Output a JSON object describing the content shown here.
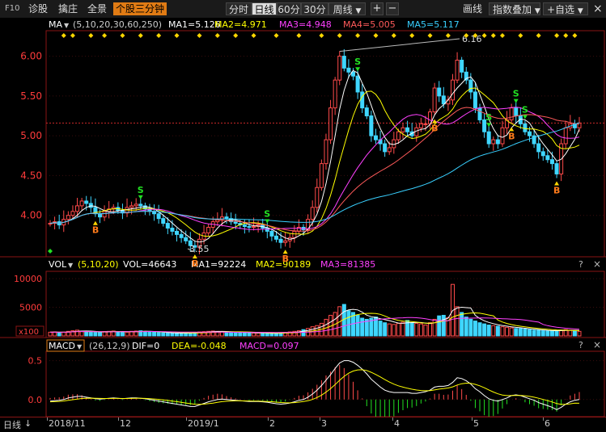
{
  "toolbar": {
    "f10": "F10",
    "nav": [
      "诊股",
      "擒庄",
      "全景",
      "个股三分钟"
    ],
    "nav_active": 3,
    "periods": [
      "分时",
      "日线",
      "60分",
      "30分",
      "周线"
    ],
    "period_active": 1,
    "dropdown_icon": "chevron-down-icon",
    "plus": "+",
    "minus": "−",
    "draw": "画线",
    "overlay": "指数叠加",
    "watchlist": "+自选",
    "close": "×"
  },
  "price_legend": {
    "name": "MA",
    "params": "(5,10,20,30,60,250)",
    "items": [
      "MA1=5.126",
      "MA2=4.971",
      "MA3=4.948",
      "MA4=5.005",
      "MA5=5.117"
    ],
    "colors": [
      "#ffffff",
      "#ffff00",
      "#ff40ff",
      "#ff5a5a",
      "#39d0ff"
    ]
  },
  "vol_legend": {
    "name": "VOL",
    "params": "(5,10,20)",
    "items": [
      "VOL=46643",
      "MA1=92224",
      "MA2=90189",
      "MA3=81385"
    ]
  },
  "macd_legend": {
    "name": "MACD",
    "params": "(26,12,9)",
    "items": [
      "DIF=0",
      "DEA=-0.048",
      "MACD=0.097"
    ]
  },
  "panel_controls": [
    "?",
    "×"
  ],
  "price_annotations": {
    "high": "6.16",
    "low": "3.55"
  },
  "signals": {
    "buy": "B",
    "sell": "S"
  },
  "vol_unit": "x100",
  "period_label": "日线",
  "x_labels": [
    "2018/11",
    "12",
    "2019/1",
    "2",
    "3",
    "4",
    "5",
    "6"
  ],
  "chart_data": [
    {
      "type": "line",
      "panel": "price",
      "ylim": [
        3.5,
        6.3
      ],
      "yticks": [
        "6.00",
        "5.50",
        "5.00",
        "4.50",
        "4.00"
      ],
      "ref_line": 5.16,
      "close": [
        3.9,
        3.92,
        3.88,
        3.95,
        4.0,
        4.05,
        4.12,
        4.18,
        4.15,
        4.1,
        4.02,
        3.98,
        4.05,
        4.08,
        4.1,
        4.06,
        4.03,
        4.1,
        4.12,
        4.14,
        4.12,
        4.08,
        4.05,
        4.02,
        3.96,
        3.9,
        3.84,
        3.8,
        3.76,
        3.72,
        3.68,
        3.62,
        3.6,
        3.7,
        3.78,
        3.85,
        3.92,
        3.95,
        3.98,
        3.96,
        3.92,
        3.9,
        3.88,
        3.86,
        3.85,
        3.86,
        3.88,
        3.84,
        3.8,
        3.74,
        3.7,
        3.66,
        3.68,
        3.72,
        3.8,
        3.85,
        3.82,
        3.95,
        4.1,
        4.35,
        4.65,
        4.95,
        5.35,
        5.7,
        6.0,
        5.85,
        5.8,
        5.75,
        5.55,
        5.35,
        5.25,
        5.0,
        4.95,
        4.9,
        4.8,
        4.85,
        4.95,
        5.05,
        5.1,
        5.05,
        5.0,
        5.1,
        5.15,
        5.15,
        5.3,
        5.6,
        5.5,
        5.4,
        5.45,
        5.7,
        5.95,
        5.8,
        5.7,
        5.55,
        5.35,
        5.2,
        5.05,
        4.9,
        4.95,
        4.9,
        5.1,
        5.2,
        5.35,
        5.25,
        5.15,
        5.05,
        5.0,
        4.9,
        4.8,
        4.75,
        4.7,
        4.65,
        4.52,
        4.9,
        5.1,
        5.15,
        5.1,
        5.16
      ]
    },
    {
      "type": "bar",
      "panel": "volume",
      "ylim": [
        0,
        11000
      ],
      "yticks": [
        "10000",
        "5000"
      ],
      "values": [
        650,
        700,
        600,
        650,
        800,
        900,
        1000,
        850,
        750,
        700,
        650,
        600,
        750,
        800,
        850,
        750,
        700,
        650,
        800,
        850,
        900,
        800,
        700,
        650,
        600,
        550,
        500,
        450,
        450,
        500,
        550,
        500,
        600,
        700,
        750,
        800,
        850,
        800,
        750,
        700,
        650,
        600,
        550,
        600,
        550,
        500,
        500,
        450,
        450,
        450,
        500,
        550,
        600,
        700,
        800,
        900,
        1100,
        1300,
        1600,
        1800,
        2200,
        2900,
        3600,
        4100,
        5100,
        5500,
        4400,
        4100,
        3600,
        3100,
        2900,
        3100,
        3300,
        2600,
        2300,
        2100,
        2000,
        2200,
        2400,
        2700,
        2300,
        2200,
        2100,
        1900,
        2300,
        2900,
        3500,
        3600,
        3200,
        9000,
        5100,
        4100,
        3300,
        2900,
        2600,
        2300,
        2100,
        1900,
        1800,
        1700,
        1600,
        1500,
        1400,
        1300,
        1300,
        1200,
        1100,
        1000,
        1000,
        900,
        900,
        850,
        900,
        1000,
        1100,
        1000,
        900,
        800
      ]
    },
    {
      "type": "line",
      "panel": "macd",
      "ylim": [
        -0.2,
        0.6
      ],
      "yticks": [
        "0.5",
        "0.0"
      ],
      "dif": [
        -0.02,
        -0.015,
        -0.01,
        0.0,
        0.02,
        0.03,
        0.04,
        0.04,
        0.03,
        0.02,
        0.01,
        0.005,
        0.01,
        0.015,
        0.02,
        0.015,
        0.01,
        0.015,
        0.02,
        0.02,
        0.015,
        0.01,
        0.0,
        -0.01,
        -0.02,
        -0.03,
        -0.04,
        -0.05,
        -0.06,
        -0.07,
        -0.08,
        -0.09,
        -0.09,
        -0.07,
        -0.05,
        -0.03,
        -0.015,
        0.0,
        0.005,
        0.0,
        -0.005,
        -0.01,
        -0.015,
        -0.02,
        -0.025,
        -0.025,
        -0.025,
        -0.03,
        -0.035,
        -0.045,
        -0.055,
        -0.06,
        -0.055,
        -0.045,
        -0.03,
        -0.01,
        0.0,
        0.03,
        0.07,
        0.12,
        0.18,
        0.25,
        0.32,
        0.4,
        0.47,
        0.5,
        0.5,
        0.48,
        0.44,
        0.39,
        0.33,
        0.26,
        0.21,
        0.16,
        0.12,
        0.1,
        0.09,
        0.09,
        0.09,
        0.09,
        0.08,
        0.08,
        0.09,
        0.1,
        0.12,
        0.16,
        0.17,
        0.17,
        0.18,
        0.22,
        0.28,
        0.27,
        0.24,
        0.2,
        0.14,
        0.1,
        0.05,
        0.01,
        -0.01,
        -0.02,
        0.0,
        0.02,
        0.05,
        0.06,
        0.05,
        0.03,
        0.01,
        -0.01,
        -0.04,
        -0.06,
        -0.08,
        -0.1,
        -0.13,
        -0.1,
        -0.06,
        -0.03,
        -0.01,
        0.0
      ],
      "dea": [
        -0.03,
        -0.028,
        -0.024,
        -0.019,
        -0.011,
        -0.003,
        0.006,
        0.013,
        0.016,
        0.017,
        0.016,
        0.014,
        0.013,
        0.013,
        0.014,
        0.014,
        0.013,
        0.013,
        0.014,
        0.015,
        0.015,
        0.014,
        0.011,
        0.007,
        0.002,
        -0.005,
        -0.012,
        -0.02,
        -0.028,
        -0.036,
        -0.045,
        -0.054,
        -0.061,
        -0.063,
        -0.06,
        -0.054,
        -0.046,
        -0.037,
        -0.028,
        -0.022,
        -0.019,
        -0.017,
        -0.017,
        -0.018,
        -0.019,
        -0.02,
        -0.021,
        -0.023,
        -0.025,
        -0.029,
        -0.034,
        -0.039,
        -0.042,
        -0.043,
        -0.04,
        -0.034,
        -0.027,
        -0.016,
        0.001,
        0.025,
        0.056,
        0.095,
        0.14,
        0.192,
        0.247,
        0.298,
        0.338,
        0.366,
        0.381,
        0.383,
        0.373,
        0.35,
        0.322,
        0.29,
        0.256,
        0.225,
        0.198,
        0.176,
        0.159,
        0.145,
        0.132,
        0.122,
        0.116,
        0.113,
        0.114,
        0.123,
        0.133,
        0.14,
        0.148,
        0.163,
        0.186,
        0.203,
        0.21,
        0.208,
        0.195,
        0.176,
        0.151,
        0.123,
        0.096,
        0.073,
        0.058,
        0.05,
        0.05,
        0.052,
        0.052,
        0.048,
        0.04,
        0.03,
        0.016,
        0.001,
        -0.015,
        -0.032,
        -0.052,
        -0.062,
        -0.062,
        -0.056,
        -0.047,
        -0.048
      ]
    }
  ]
}
